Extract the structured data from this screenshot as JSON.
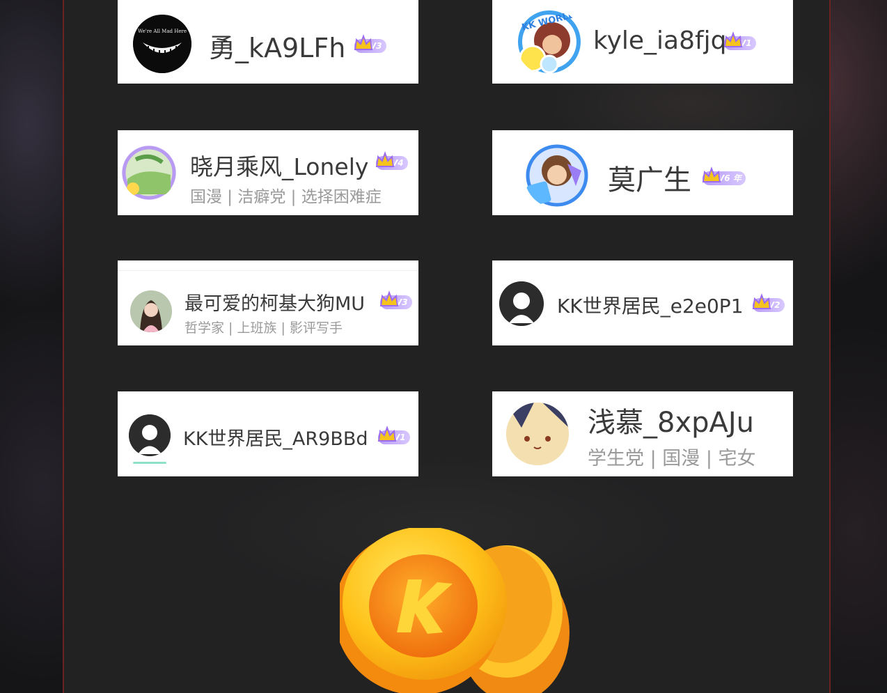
{
  "users": [
    {
      "name": "勇_kA9LFh",
      "tags": "",
      "badge": "V3"
    },
    {
      "name": "kyle_ia8fjq",
      "tags": "",
      "badge": "V1"
    },
    {
      "name": "晓月乘风_Lonely",
      "tags": "国漫 | 洁癖党 | 选择困难症",
      "badge": "V4"
    },
    {
      "name": "莫广生",
      "tags": "",
      "badge": "V6 年"
    },
    {
      "name": "最可爱的柯基大狗MU",
      "tags": "哲学家 | 上班族 | 影评写手",
      "badge": "V3"
    },
    {
      "name": "KK世界居民_e2e0P1",
      "tags": "",
      "badge": "V2"
    },
    {
      "name": "KK世界居民_AR9BBd",
      "tags": "",
      "badge": "V1"
    },
    {
      "name": "浅慕_8xpAJu",
      "tags": "学生党 | 国漫 | 宅女",
      "badge": ""
    }
  ],
  "avatar_texts": {
    "smile_logo": "We're All Mad Here",
    "kk_world": "KK WORLD"
  },
  "coin_letter": "K",
  "colors": {
    "badge_purple": "#b79af5",
    "panel_border": "#6a2320",
    "coin_orange": "#f07a12",
    "coin_yellow": "#ffd21f"
  },
  "icons": [
    "crown-icon",
    "coin-icon"
  ]
}
